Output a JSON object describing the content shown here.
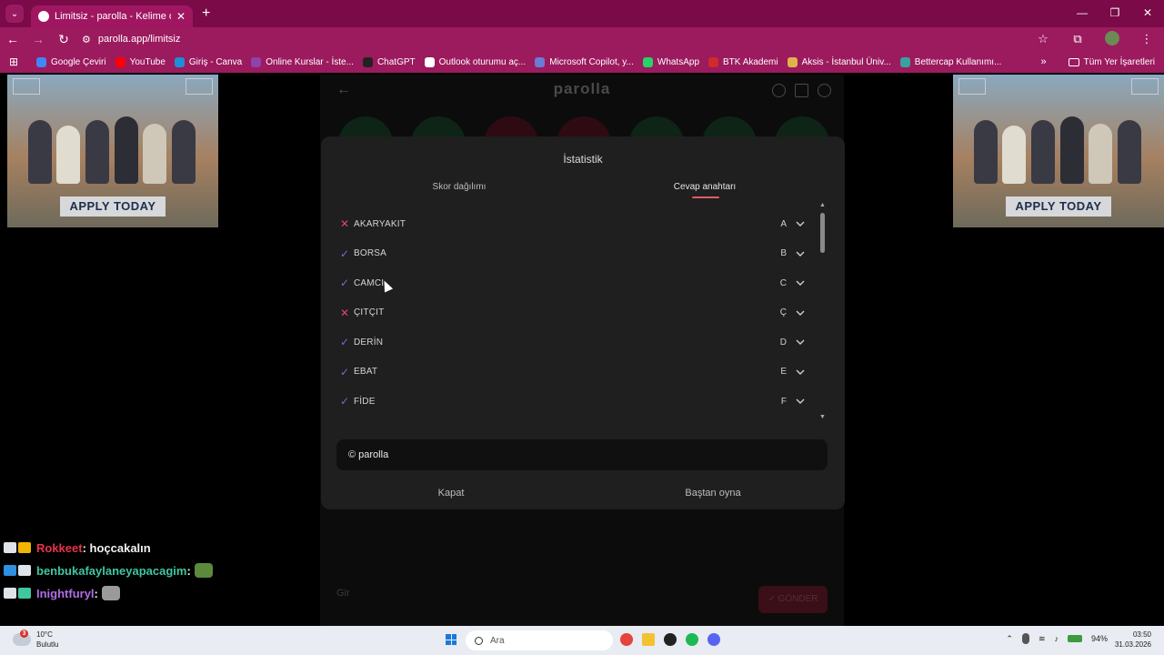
{
  "browser": {
    "tab_title": "Limitsiz - parolla - Kelime oyunu",
    "tab_close": "✕",
    "new_tab": "+",
    "url": "parolla.app/limitsiz",
    "window_controls": [
      "—",
      "❐",
      "✕"
    ],
    "bookmarks": [
      {
        "label": "Google Çeviri",
        "color": "#4285f4"
      },
      {
        "label": "YouTube",
        "color": "#ff0000"
      },
      {
        "label": "Giriş - Canva",
        "color": "#1c8fd6"
      },
      {
        "label": "Online Kurslar - İste...",
        "color": "#8e44ad"
      },
      {
        "label": "ChatGPT",
        "color": "#222222"
      },
      {
        "label": "Outlook oturumu aç...",
        "color": "#ffffff"
      },
      {
        "label": "Microsoft Copilot, y...",
        "color": "#6b7bd6"
      },
      {
        "label": "WhatsApp",
        "color": "#25d366"
      },
      {
        "label": "BTK Akademi",
        "color": "#d12a2a"
      },
      {
        "label": "Aksis - İstanbul Üniv...",
        "color": "#e0b34a"
      },
      {
        "label": "Bettercap Kullanımı...",
        "color": "#3aa0a0"
      }
    ],
    "bookmarks_more": "»",
    "all_bookmarks": "Tüm Yer İşaretleri"
  },
  "ads": {
    "apply_label": "APPLY TODAY"
  },
  "game": {
    "brand": "parolla",
    "input_placeholder": "Gir",
    "send_label": "✓ GÖNDER"
  },
  "modal": {
    "title": "İstatistik",
    "tabs": [
      "Skor dağılımı",
      "Cevap anahtarı"
    ],
    "answers": [
      {
        "word": "AKARYAKIT",
        "letter": "A",
        "correct": false
      },
      {
        "word": "BORSA",
        "letter": "B",
        "correct": true
      },
      {
        "word": "CAMCI",
        "letter": "C",
        "correct": true
      },
      {
        "word": "ÇITÇIT",
        "letter": "Ç",
        "correct": false
      },
      {
        "word": "DERİN",
        "letter": "D",
        "correct": true
      },
      {
        "word": "EBAT",
        "letter": "E",
        "correct": true
      },
      {
        "word": "FİDE",
        "letter": "F",
        "correct": true
      }
    ],
    "copyright": "© parolla",
    "close_label": "Kapat",
    "replay_label": "Baştan oyna"
  },
  "chat": [
    {
      "user": "Rokkeet",
      "message": ": hoçcakalın",
      "color": "#e8324a"
    },
    {
      "user": "benbukafaylaneyapacagim",
      "message": " :",
      "color": "#3fc7a0"
    },
    {
      "user": "Inightfuryl",
      "message": " :",
      "color": "#b36ce8"
    }
  ],
  "taskbar": {
    "temperature": "10°C",
    "weather_text": "Bulutlu",
    "weather_badge": "3",
    "search_placeholder": "Ara",
    "battery": "94%",
    "time": "03:50",
    "date": "31.03.2026"
  }
}
